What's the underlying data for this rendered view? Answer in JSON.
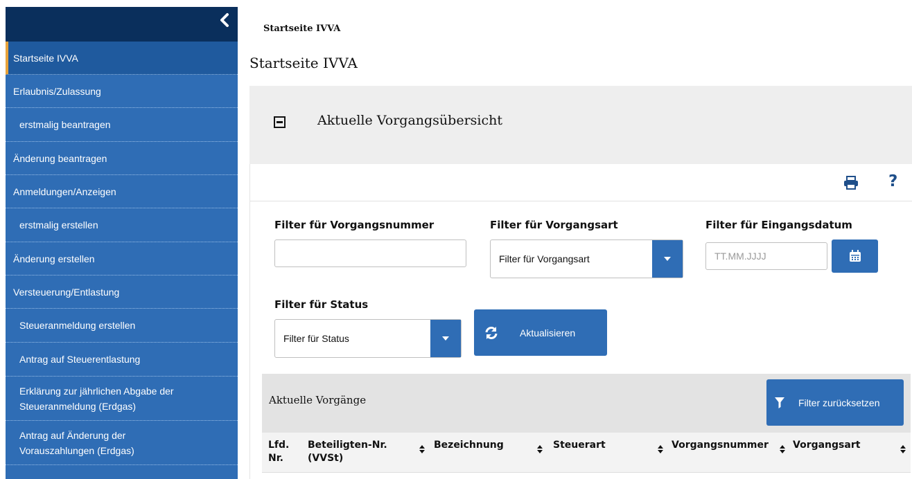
{
  "sidebar": {
    "items": [
      {
        "label": "Startseite IVVA"
      },
      {
        "label": "Erlaubnis/Zulassung"
      },
      {
        "label": "erstmalig beantragen"
      },
      {
        "label": "Änderung beantragen"
      },
      {
        "label": "Anmeldungen/Anzeigen"
      },
      {
        "label": "erstmalig erstellen"
      },
      {
        "label": "Änderung erstellen"
      },
      {
        "label": "Versteuerung/Entlastung"
      },
      {
        "label": "Steueranmeldung erstellen"
      },
      {
        "label": "Antrag auf Steuerentlastung"
      },
      {
        "label_line1": "Erklärung zur jährlichen Abgabe der",
        "label_line2": "Steueranmeldung (Erdgas)"
      },
      {
        "label_line1": "Antrag auf Änderung der",
        "label_line2": "Vorauszahlungen (Erdgas)"
      }
    ]
  },
  "breadcrumb": "Startseite IVVA",
  "page_title": "Startseite IVVA",
  "panel": {
    "title": "Aktuelle Vorgangsübersicht",
    "help_label": "?"
  },
  "filters": {
    "vorgangsnummer_label": "Filter für Vorgangsnummer",
    "vorgangsnummer_value": "",
    "vorgangsart_label": "Filter für Vorgangsart",
    "vorgangsart_value": "Filter für Vorgangsart",
    "eingangsdatum_label": "Filter für Eingangsdatum",
    "eingangsdatum_placeholder": "TT.MM.JJJJ",
    "status_label": "Filter für Status",
    "status_value": "Filter für Status",
    "refresh_label": "Aktualisieren"
  },
  "table": {
    "title": "Aktuelle Vorgänge",
    "reset_label": "Filter zurücksetzen",
    "columns": [
      {
        "line1": "Lfd.",
        "line2": "Nr."
      },
      {
        "line1": "Beteiligten-Nr.",
        "line2": "(VVSt)"
      },
      {
        "line1": "Bezeichnung",
        "line2": ""
      },
      {
        "line1": "Steuerart",
        "line2": ""
      },
      {
        "line1": "Vorgangsnummer",
        "line2": ""
      },
      {
        "line1": "Vorgangsart",
        "line2": ""
      }
    ]
  },
  "colors": {
    "sidebar": "#2f6db5",
    "sidebar_top": "#0a2f5c",
    "active_marker": "#e8a33a",
    "button": "#2f6db5"
  },
  "icons": [
    "chevron-left-icon",
    "minus-square-icon",
    "print-icon",
    "help-icon",
    "caret-down-icon",
    "calendar-icon",
    "refresh-icon",
    "filter-icon",
    "sort-icon"
  ]
}
